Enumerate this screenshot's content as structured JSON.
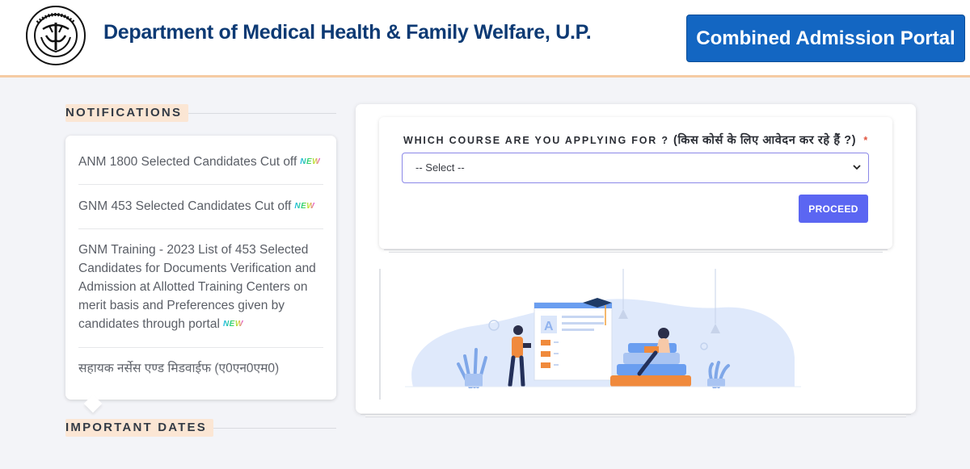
{
  "header": {
    "logo_label": "उत्तर प्रदेश सरकार",
    "department_title": "Department of Medical Health & Family Welfare, U.P.",
    "portal_button": "Combined Admission Portal"
  },
  "notifications": {
    "heading": "NOTIFICATIONS",
    "badge_label": "NEW",
    "items": [
      {
        "text": "ANM 1800 Selected Candidates Cut off",
        "is_new": true
      },
      {
        "text": "GNM 453 Selected Candidates Cut off",
        "is_new": true
      },
      {
        "text": "GNM Training - 2023 List of 453 Selected Candidates for Documents Verification and Admission at Allotted Training Centers on merit basis and Preferences given by candidates through portal",
        "is_new": true
      },
      {
        "text": "सहायक नर्सेस एण्ड मिडवाईफ (ए0एन0एम0)",
        "is_new": false
      }
    ]
  },
  "important_dates": {
    "heading": "IMPORTANT DATES"
  },
  "course_form": {
    "label_en": "WHICH COURSE ARE YOU APPLYING FOR ?",
    "label_hi": "(किस कोर्स के लिए आवेदन कर रहे हैं ?)",
    "required_mark": "*",
    "select_value": "-- Select --",
    "proceed_button": "PROCEED"
  },
  "colors": {
    "brand_blue": "#1366c2",
    "title_navy": "#0d3a74",
    "accent_purple": "#5b66f2",
    "section_pill": "#fbe6d4",
    "required_red": "#e0543f"
  },
  "icons": {
    "logo": "up-government-emblem",
    "select_chevron": "chevron-down-icon",
    "illustration": "online-learning-illustration"
  }
}
